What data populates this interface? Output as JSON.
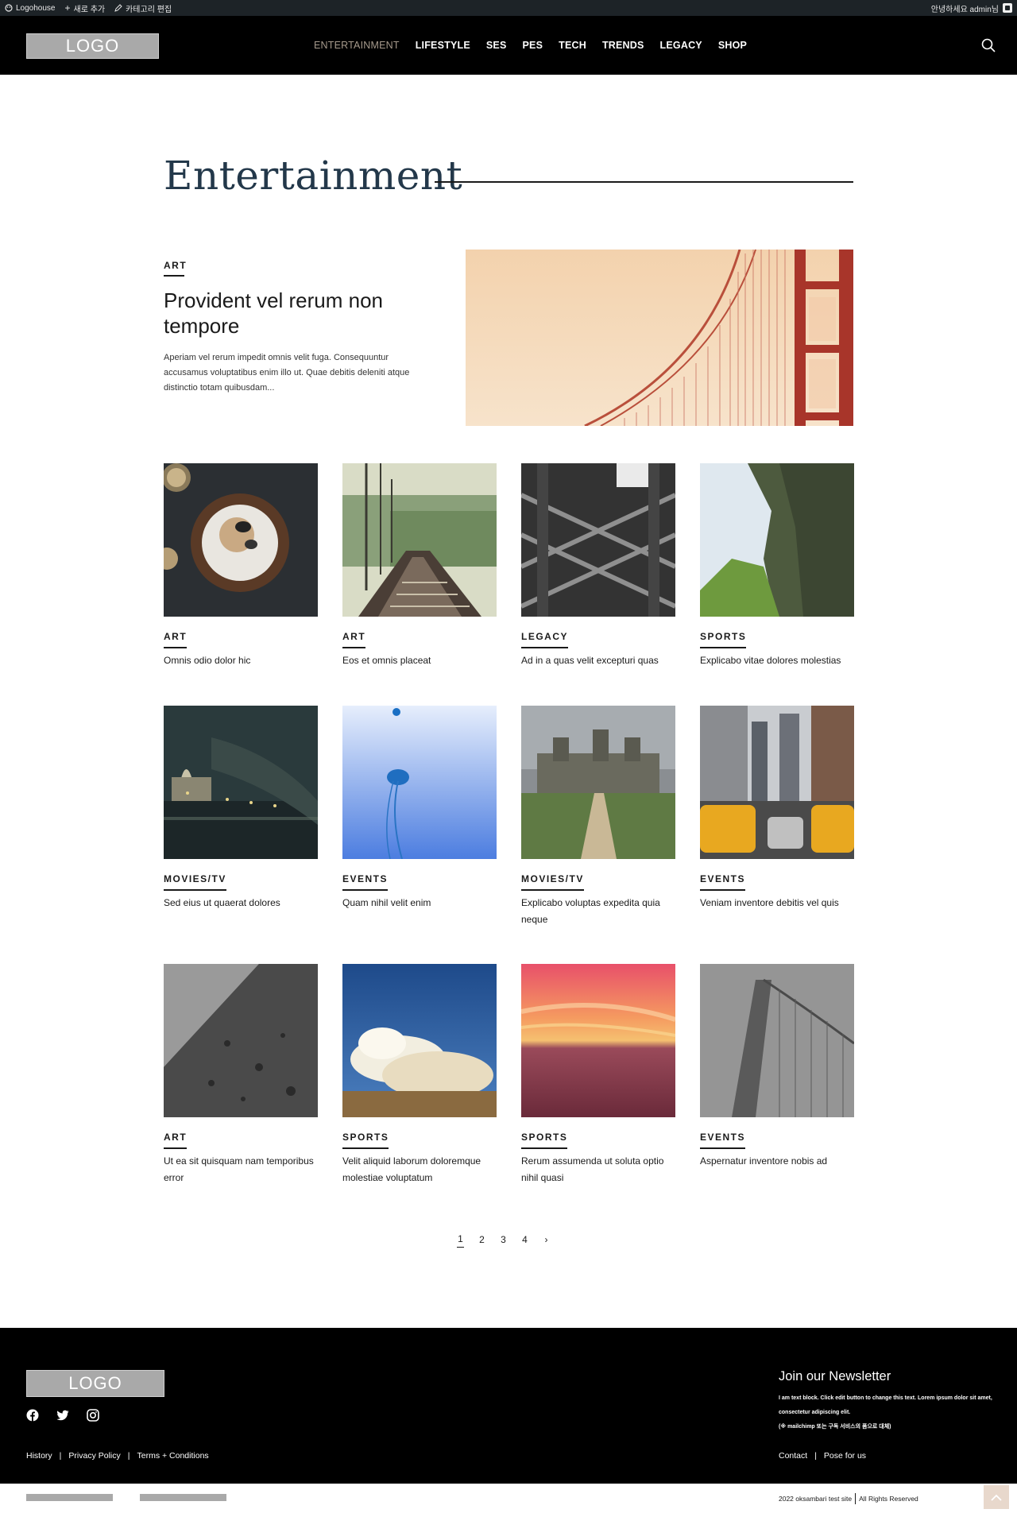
{
  "admin_bar": {
    "site": "Logohouse",
    "new": "새로 추가",
    "edit": "카테고리 편집",
    "greeting": "안녕하세요 admin님"
  },
  "header": {
    "logo": "LOGO",
    "nav": [
      "ENTERTAINMENT",
      "LIFESTYLE",
      "SES",
      "PES",
      "TECH",
      "TRENDS",
      "LEGACY",
      "SHOP"
    ],
    "active_nav": "ENTERTAINMENT"
  },
  "page": {
    "title": "Entertainment"
  },
  "featured": {
    "category": "ART",
    "title": "Provident vel rerum non tempore",
    "excerpt": "Aperiam vel rerum impedit omnis velit fuga. Consequuntur accusamus voluptatibus enim illo ut. Quae debitis deleniti atque distinctio totam quibusdam..."
  },
  "posts": [
    {
      "category": "ART",
      "title": "Omnis odio dolor hic"
    },
    {
      "category": "ART",
      "title": "Eos et omnis placeat"
    },
    {
      "category": "LEGACY",
      "title": "Ad in a quas velit excepturi quas"
    },
    {
      "category": "SPORTS",
      "title": "Explicabo vitae dolores molestias"
    },
    {
      "category": "MOVIES/TV",
      "title": "Sed eius ut quaerat dolores"
    },
    {
      "category": "EVENTS",
      "title": "Quam nihil velit enim"
    },
    {
      "category": "MOVIES/TV",
      "title": "Explicabo voluptas expedita quia neque"
    },
    {
      "category": "EVENTS",
      "title": "Veniam inventore debitis vel quis"
    },
    {
      "category": "ART",
      "title": "Ut ea sit quisquam nam temporibus error"
    },
    {
      "category": "SPORTS",
      "title": "Velit aliquid laborum doloremque molestiae voluptatum"
    },
    {
      "category": "SPORTS",
      "title": "Rerum assumenda ut soluta optio nihil quasi"
    },
    {
      "category": "EVENTS",
      "title": "Aspernatur inventore nobis ad"
    }
  ],
  "pagination": {
    "pages": [
      "1",
      "2",
      "3",
      "4"
    ],
    "current": "1",
    "next": "›"
  },
  "footer": {
    "logo": "LOGO",
    "links_left": [
      "History",
      "Privacy Policy",
      "Terms + Conditions"
    ],
    "newsletter_title": "Join our Newsletter",
    "newsletter_text": "I am text block. Click edit button to change this text. Lorem ipsum dolor sit amet, consectetur adipiscing elit.",
    "newsletter_note": "(※ mailchimp 또는 구독 서비스의 폼으로 대체)",
    "links_right": [
      "Contact",
      "Pose for us"
    ]
  },
  "bottom": {
    "copyright": "2022 oksambari test site",
    "rights": "All Rights Reserved"
  }
}
